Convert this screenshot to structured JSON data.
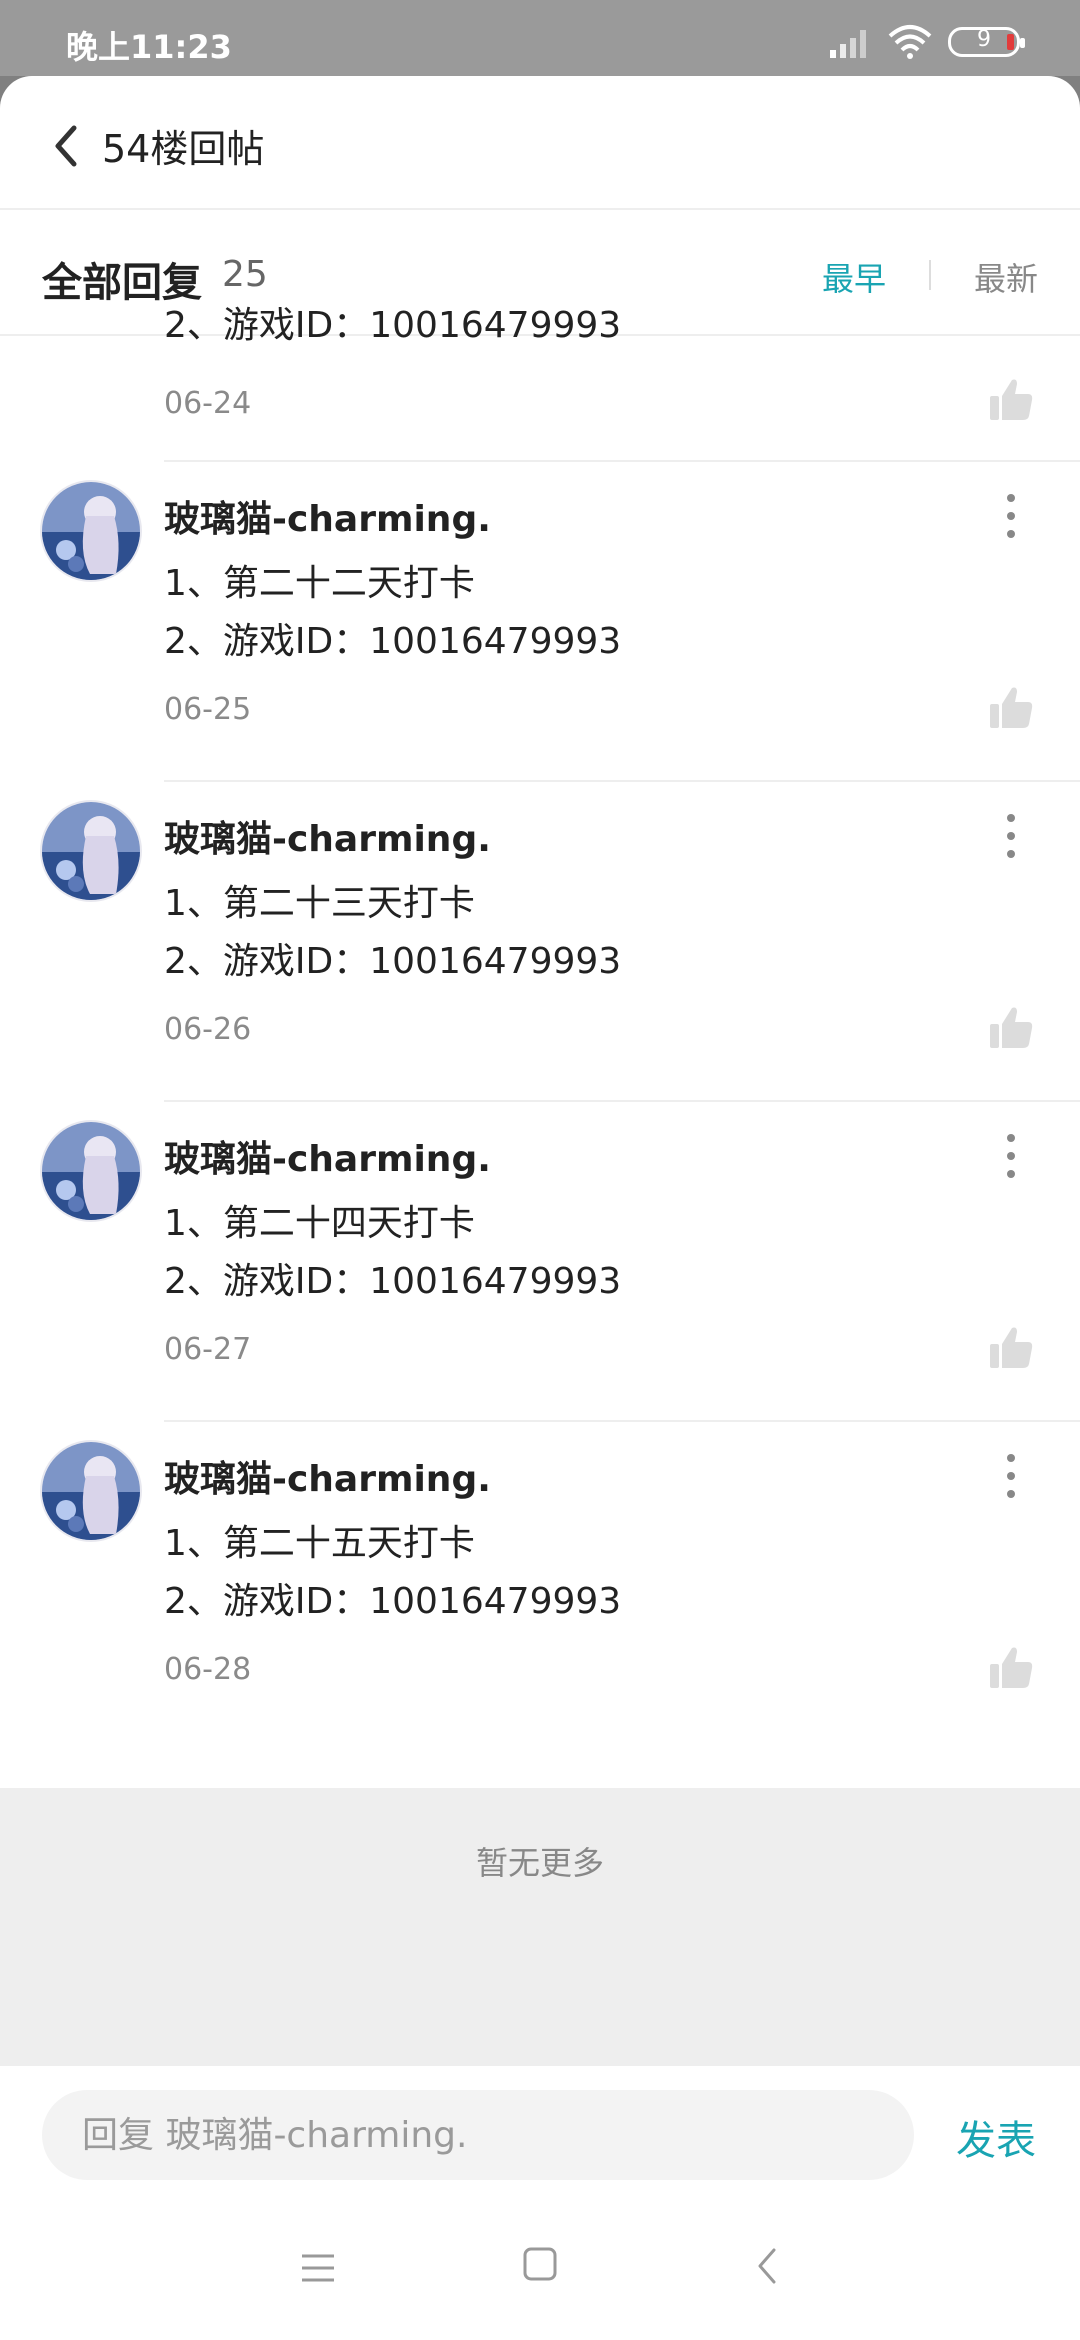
{
  "status_bar": {
    "time": "晚上11:23",
    "battery_level": "9",
    "icons": [
      "signal-icon",
      "wifi-icon",
      "battery-icon"
    ]
  },
  "header": {
    "title": "54楼回帖",
    "back_icon": "chevron-left-icon"
  },
  "subheader": {
    "title": "全部回复",
    "count": "25",
    "sort_earliest": "最早",
    "sort_newest": "最新",
    "active_sort": "最早"
  },
  "replies": [
    {
      "author": "",
      "line1": "",
      "line2": "2、游戏ID：10016479993",
      "date": "06-24"
    },
    {
      "author": "玻璃猫-charming.",
      "line1": "1、第二十二天打卡",
      "line2": "2、游戏ID：10016479993",
      "date": "06-25"
    },
    {
      "author": "玻璃猫-charming.",
      "line1": "1、第二十三天打卡",
      "line2": "2、游戏ID：10016479993",
      "date": "06-26"
    },
    {
      "author": "玻璃猫-charming.",
      "line1": "1、第二十四天打卡",
      "line2": "2、游戏ID：10016479993",
      "date": "06-27"
    },
    {
      "author": "玻璃猫-charming.",
      "line1": "1、第二十五天打卡",
      "line2": "2、游戏ID：10016479993",
      "date": "06-28"
    }
  ],
  "no_more_text": "暂无更多",
  "compose": {
    "placeholder": "回复 玻璃猫-charming.",
    "submit_label": "发表"
  },
  "colors": {
    "accent": "#19a4b2",
    "muted": "#888888",
    "background_gray": "#eeeeee"
  }
}
